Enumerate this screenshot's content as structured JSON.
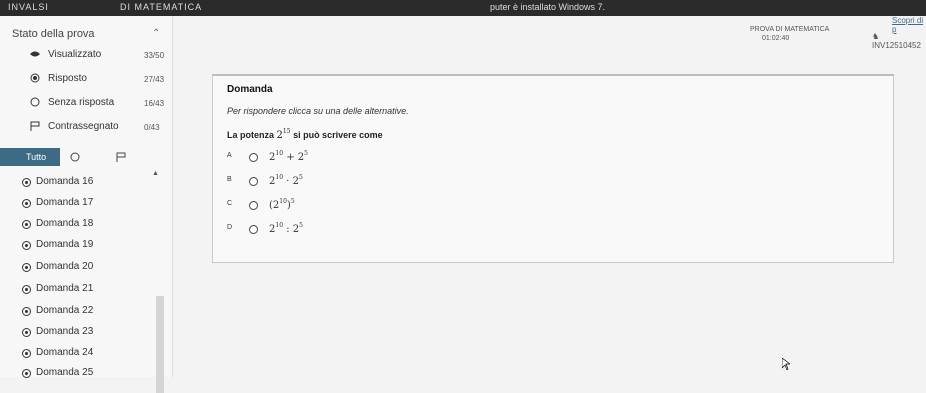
{
  "topbar": {
    "left_text": "INVALSI",
    "left_text2": "DI MATEMATICA",
    "center_text": "puter è installato Windows 7."
  },
  "sidebar": {
    "title": "Stato della prova",
    "summary": [
      {
        "label": "Visualizzato",
        "count": "33/50",
        "icon": "eye-icon"
      },
      {
        "label": "Risposto",
        "count": "27/43",
        "icon": "radio-filled-icon"
      },
      {
        "label": "Senza risposta",
        "count": "16/43",
        "icon": "radio-empty-icon"
      },
      {
        "label": "Contrassegnato",
        "count": "0/43",
        "icon": "flag-icon"
      }
    ],
    "filter_all": "Tutto",
    "questions": [
      "Domanda 16",
      "Domanda 17",
      "Domanda 18",
      "Domanda 19",
      "Domanda 20",
      "Domanda 21",
      "Domanda 22",
      "Domanda 23",
      "Domanda 24",
      "Domanda 25"
    ]
  },
  "header": {
    "test_name": "PROVA DI MATEMATICA",
    "timer": "01:02:40",
    "user": "INV12510452",
    "link": "Scopri di p"
  },
  "question": {
    "title": "Domanda",
    "instruction": "Per rispondere clicca su una delle alternative.",
    "stem_prefix": "La potenza",
    "stem_base": "2",
    "stem_exp": "15",
    "stem_suffix": "si può scrivere come",
    "options": [
      {
        "letter": "A",
        "b1": "2",
        "e1": "10",
        "op": " + ",
        "b2": "2",
        "e2": "5"
      },
      {
        "letter": "B",
        "b1": "2",
        "e1": "10",
        "op": " · ",
        "b2": "2",
        "e2": "5"
      },
      {
        "letter": "C",
        "b1": "(2",
        "e1": "10",
        "op": ")",
        "b2": "",
        "e2": "5"
      },
      {
        "letter": "D",
        "b1": "2",
        "e1": "10",
        "op": " : ",
        "b2": "2",
        "e2": "5"
      }
    ]
  }
}
